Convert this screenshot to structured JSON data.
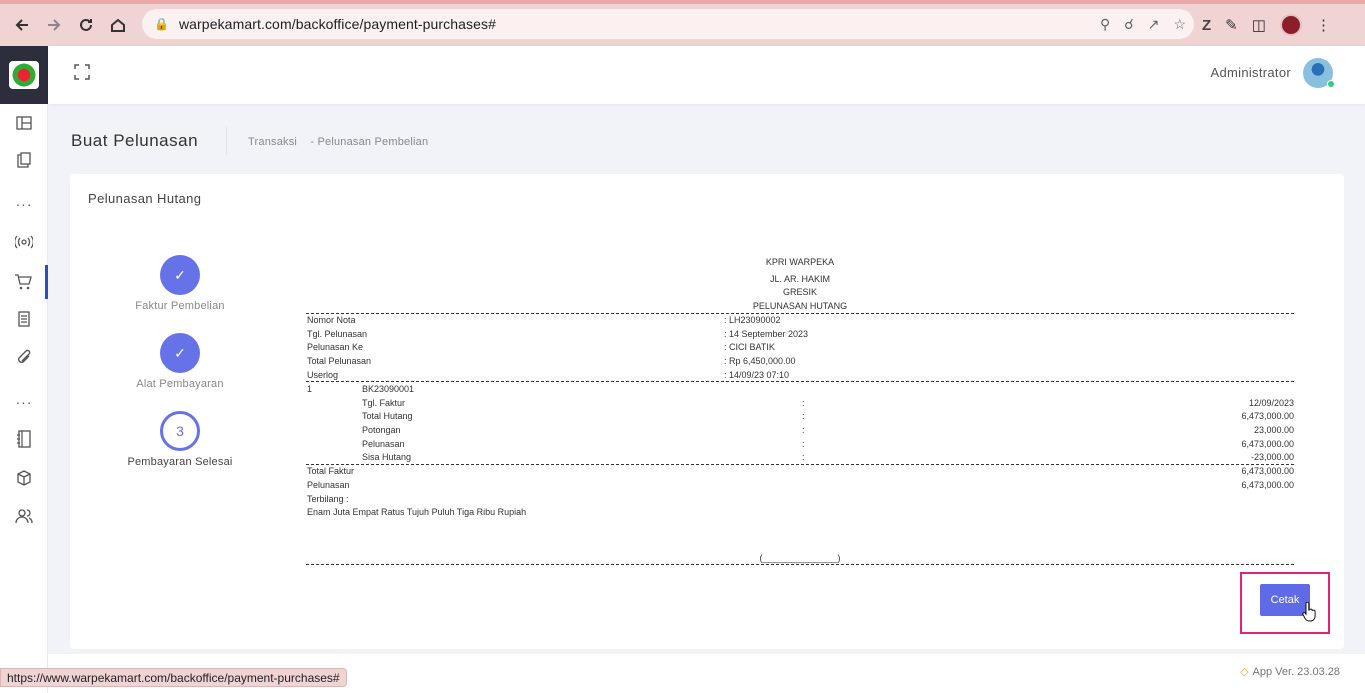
{
  "browser": {
    "url": "warpekamart.com/backoffice/payment-purchases#",
    "status_url": "https://www.warpekamart.com/backoffice/payment-purchases#"
  },
  "topbar": {
    "user_name": "Administrator"
  },
  "page": {
    "title": "Buat Pelunasan",
    "breadcrumb": [
      "Transaksi",
      "- Pelunasan Pembelian"
    ]
  },
  "card": {
    "title": "Pelunasan Hutang",
    "steps": [
      {
        "number": "✓",
        "label": "Faktur Pembelian",
        "state": "done"
      },
      {
        "number": "✓",
        "label": "Alat Pembayaran",
        "state": "done"
      },
      {
        "number": "3",
        "label": "Pembayaran Selesai",
        "state": "current"
      }
    ]
  },
  "receipt": {
    "header": [
      "KPRI WARPEKA",
      "JL. AR. HAKIM",
      "GRESIK",
      "PELUNASAN HUTANG"
    ],
    "info": [
      {
        "label": "Nomor Nota",
        "value": ": LH23090002"
      },
      {
        "label": "Tgl. Pelunasan",
        "value": ": 14 September 2023"
      },
      {
        "label": "Pelunasan Ke",
        "value": ": CICI BATIK"
      },
      {
        "label": "Total Pelunasan",
        "value": ": Rp 6,450,000.00"
      },
      {
        "label": "Userlog",
        "value": ": 14/09/23 07:10"
      }
    ],
    "item_no": "1",
    "item_code": "BK23090001",
    "item_rows": [
      {
        "label": "Tgl. Faktur",
        "colon": ":",
        "value": "12/09/2023"
      },
      {
        "label": "Total Hutang",
        "colon": ":",
        "value": "6,473,000.00"
      },
      {
        "label": "Potongan",
        "colon": ":",
        "value": "23,000.00"
      },
      {
        "label": "Pelunasan",
        "colon": ":",
        "value": "6,473,000.00"
      },
      {
        "label": "Sisa Hutang",
        "colon": ":",
        "value": "-23,000.00"
      }
    ],
    "totals": [
      {
        "label": "Total Faktur",
        "value": "6,473,000.00"
      },
      {
        "label": "Pelunasan",
        "value": "6,473,000.00"
      }
    ],
    "terbilang_label": "Terbilang :",
    "terbilang_text": "Enam Juta Empat Ratus Tujuh Puluh Tiga Ribu Rupiah",
    "signature": "(_______________)"
  },
  "actions": {
    "print_label": "Cetak"
  },
  "footer": {
    "version": "App Ver. 23.03.28"
  },
  "colors": {
    "accent": "#5f6ae6",
    "highlight": "#e0247a",
    "browser_bar": "#f0d3d3"
  }
}
